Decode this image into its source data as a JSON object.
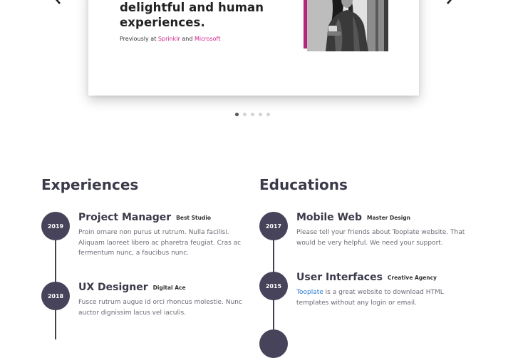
{
  "hero": {
    "headline_line1": "delightful and human",
    "headline_line2": "experiences.",
    "previously_prefix": "Previously at",
    "company1": "Sprinklr",
    "and_word": "and",
    "company2": "Microsoft",
    "prev_icon": "chevron-left-icon",
    "next_icon": "chevron-right-icon",
    "dots_count": 5,
    "active_dot": 0,
    "accent_color": "#b5247d"
  },
  "experiences": {
    "title": "Experiences",
    "items": [
      {
        "year": "2019",
        "role": "Project Manager",
        "org": "Best Studio",
        "desc": "Proin ornare non purus ut rutrum. Nulla facilisi. Aliquam laoreet libero ac pharetra feugiat. Cras ac fermentum nunc, a faucibus nunc."
      },
      {
        "year": "2018",
        "role": "UX Designer",
        "org": "Digital Ace",
        "desc": "Fusce rutrum augue id orci rhoncus molestie. Nunc auctor dignissim lacus vel iaculis."
      }
    ]
  },
  "educations": {
    "title": "Educations",
    "items": [
      {
        "year": "2017",
        "role": "Mobile Web",
        "org": "Master Design",
        "desc": "Please tell your friends about Tooplate website. That would be very helpful. We need your support."
      },
      {
        "year": "2015",
        "role": "User Interfaces",
        "org": "Creative Agency",
        "link": "Tooplate",
        "desc": " is a great website to download HTML templates without any login or email."
      }
    ]
  },
  "colors": {
    "badge": "#46435a",
    "link": "#2a7ad0",
    "pink": "#d0268a"
  }
}
